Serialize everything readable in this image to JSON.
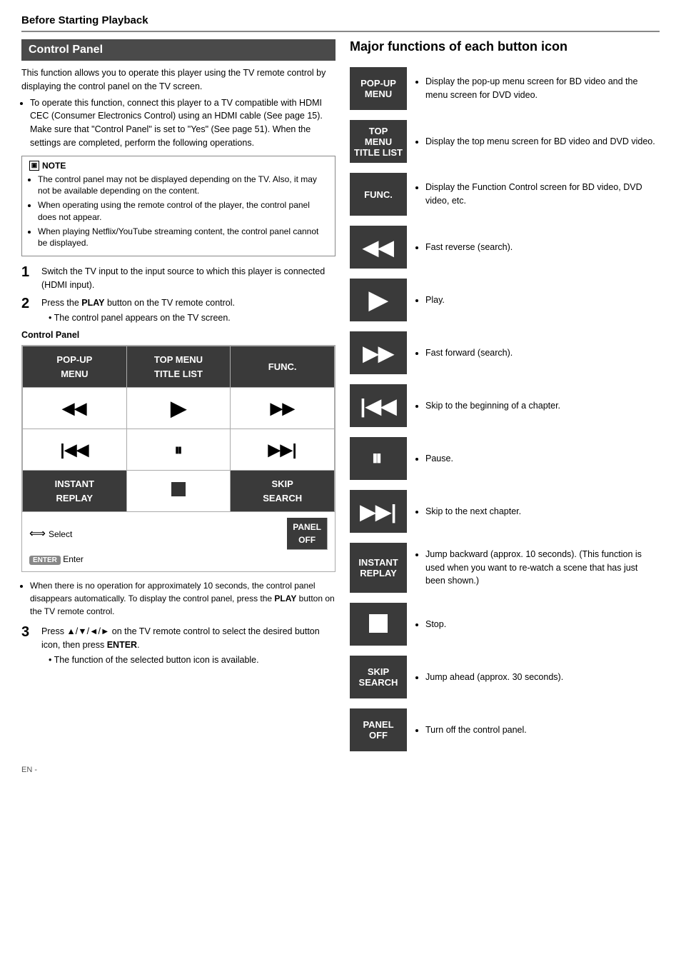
{
  "page": {
    "title": "Before Starting Playback"
  },
  "left": {
    "section_title": "Control Panel",
    "intro": "This function allows you to operate this player using the TV remote control by displaying the control panel on the TV screen.",
    "bullets": [
      "To operate this function, connect this player to a TV compatible with HDMI CEC (Consumer Electronics Control) using an HDMI cable (See page 15). Make sure that \"Control Panel\" is set to \"Yes\" (See page 51). When the settings are completed, perform the following operations."
    ],
    "note_title": "NOTE",
    "notes": [
      "The control panel may not be displayed depending on the TV. Also, it may not be available depending on the content.",
      "When operating using the remote control of the player, the control panel does not appear.",
      "When playing Netflix/YouTube streaming content, the control panel cannot be displayed."
    ],
    "steps": [
      {
        "num": "1",
        "text": "Switch the TV input to the input source to which this player is connected (HDMI input)."
      },
      {
        "num": "2",
        "text_before": "Press the ",
        "bold": "PLAY",
        "text_after": " button on the TV remote control.",
        "sub": "The control panel appears on the TV screen."
      },
      {
        "num": "3",
        "text_before": "Press ▲/▼/◄/► on the TV remote control to select the desired button icon, then press ",
        "bold": "ENTER",
        "text_after": ".",
        "sub": "The function of the selected button icon is available."
      }
    ],
    "cp_label": "Control Panel",
    "grid": [
      [
        "POP-UP\nMENU",
        "TOP MENU\nTITLE LIST",
        "FUNC."
      ],
      [
        "◄◄",
        "▶",
        "▶▶"
      ],
      [
        "I◄◄",
        "II",
        "▶▶I"
      ],
      [
        "INSTANT\nREPLAY",
        "■",
        "SKIP\nSEARCH"
      ],
      [
        "select_row",
        "",
        "PANEL\nOFF"
      ]
    ],
    "after_note": "When there is no operation for approximately 10 seconds, the control panel disappears automatically. To display the control panel, press the PLAY button on the TV remote control."
  },
  "right": {
    "title": "Major functions of each button icon",
    "buttons": [
      {
        "label": "POP-UP\nMENU",
        "desc": "Display the pop-up menu screen for BD video and the menu screen for DVD video."
      },
      {
        "label": "TOP MENU\nTITLE LIST",
        "desc": "Display the top menu screen for BD video and DVD video."
      },
      {
        "label": "FUNC.",
        "desc": "Display the Function Control screen for BD video, DVD video, etc."
      },
      {
        "label": "◄◄",
        "desc": "Fast reverse (search).",
        "sym": true
      },
      {
        "label": "▶",
        "desc": "Play.",
        "sym": true
      },
      {
        "label": "▶▶",
        "desc": "Fast forward (search).",
        "sym": true
      },
      {
        "label": "I◄◄",
        "desc": "Skip to the beginning of a chapter.",
        "sym": true
      },
      {
        "label": "II",
        "desc": "Pause.",
        "sym": true
      },
      {
        "label": "▶▶I",
        "desc": "Skip to the next chapter.",
        "sym": true
      },
      {
        "label": "INSTANT\nREPLAY",
        "desc": "Jump backward (approx. 10 seconds). (This function is used when you want to re-watch a scene that has just been shown.)"
      },
      {
        "label": "■",
        "desc": "Stop.",
        "sym_stop": true
      },
      {
        "label": "SKIP\nSEARCH",
        "desc": "Jump ahead (approx. 30 seconds)."
      },
      {
        "label": "PANEL\nOFF",
        "desc": "Turn off the control panel."
      }
    ]
  },
  "footer": {
    "label": "EN"
  }
}
